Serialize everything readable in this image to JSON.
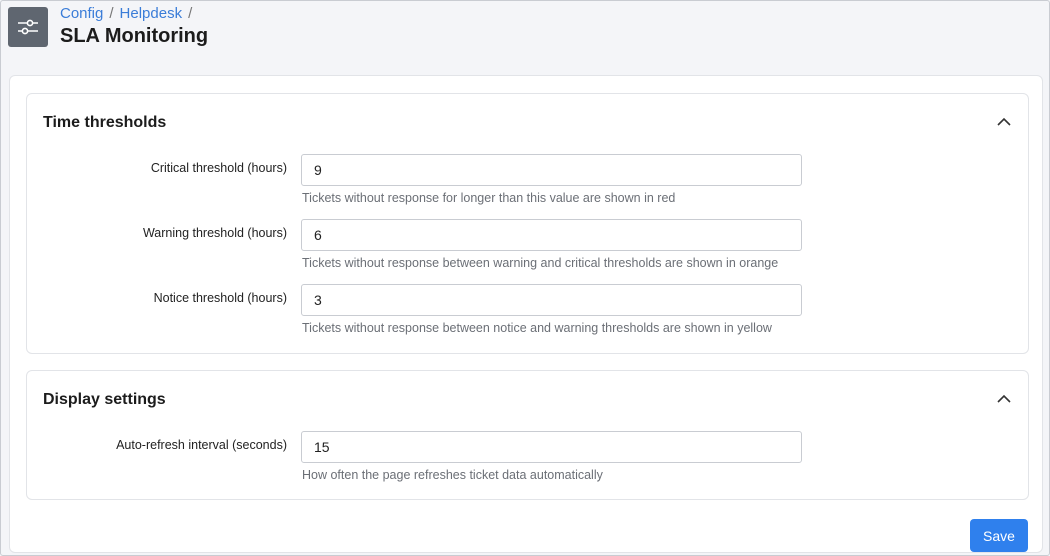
{
  "header": {
    "icon": "sliders-icon",
    "breadcrumb": [
      {
        "label": "Config",
        "separator": "/"
      },
      {
        "label": "Helpdesk",
        "separator": "/"
      }
    ],
    "title": "SLA Monitoring"
  },
  "sections": [
    {
      "title": "Time thresholds",
      "collapse_icon": "chevron-up-icon",
      "fields": [
        {
          "label": "Critical threshold (hours)",
          "value": "9",
          "hint": "Tickets without response for longer than this value are shown in red"
        },
        {
          "label": "Warning threshold (hours)",
          "value": "6",
          "hint": "Tickets without response between warning and critical thresholds are shown in orange"
        },
        {
          "label": "Notice threshold (hours)",
          "value": "3",
          "hint": "Tickets without response between notice and warning thresholds are shown in yellow"
        }
      ]
    },
    {
      "title": "Display settings",
      "collapse_icon": "chevron-up-icon",
      "fields": [
        {
          "label": "Auto-refresh interval (seconds)",
          "value": "15",
          "hint": "How often the page refreshes ticket data automatically"
        }
      ]
    }
  ],
  "actions": {
    "save_label": "Save"
  },
  "colors": {
    "accent": "#2f80ed",
    "header_icon_bg": "#5f6670",
    "link": "#3b7dd8"
  }
}
